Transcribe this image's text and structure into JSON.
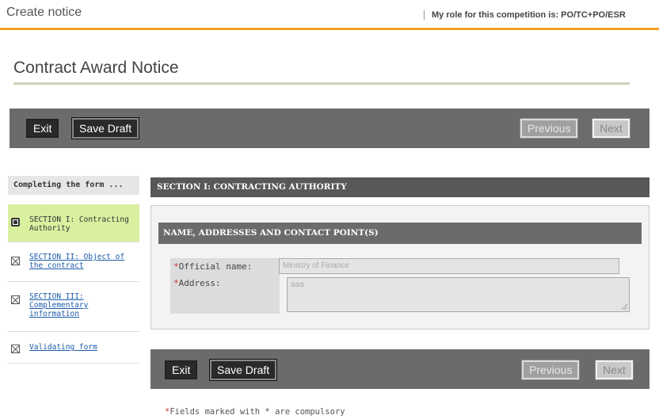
{
  "header": {
    "title": "Create notice",
    "role_text": "My role for this competition is: PO/TC+PO/ESR"
  },
  "page": {
    "title": "Contract Award Notice"
  },
  "toolbar": {
    "exit_label": "Exit",
    "save_label": "Save Draft",
    "previous_label": "Previous",
    "next_label": "Next"
  },
  "sidebar": {
    "heading": "Completing the form ...",
    "items": [
      {
        "label": "SECTION I: Contracting Authority",
        "state": "current",
        "icon": "current-section-icon"
      },
      {
        "label": "SECTION II: Object of the contract",
        "state": "incomplete",
        "icon": "checkbox-x-icon"
      },
      {
        "label": "SECTION III: Complementary information",
        "state": "incomplete",
        "icon": "checkbox-x-icon"
      },
      {
        "label": "Validating form",
        "state": "incomplete",
        "icon": "checkbox-x-icon"
      }
    ]
  },
  "section": {
    "title": "SECTION I: CONTRACTING AUTHORITY",
    "subsection_title": "NAME, ADDRESSES AND CONTACT POINT(S)",
    "fields": {
      "official_name": {
        "required_mark": "*",
        "label": "Official name:",
        "value": "Ministry of Finance"
      },
      "address": {
        "required_mark": "*",
        "label": "Address:",
        "value": "aaa"
      }
    }
  },
  "footer": {
    "required_mark": "*",
    "note": "Fields marked with * are compulsory"
  },
  "colors": {
    "accent_orange": "#f0a020",
    "toolbar_gray": "#6b6b6b",
    "current_section_green": "#d9f0a0",
    "link_blue": "#1a5aa8",
    "required_red": "#c33333"
  }
}
